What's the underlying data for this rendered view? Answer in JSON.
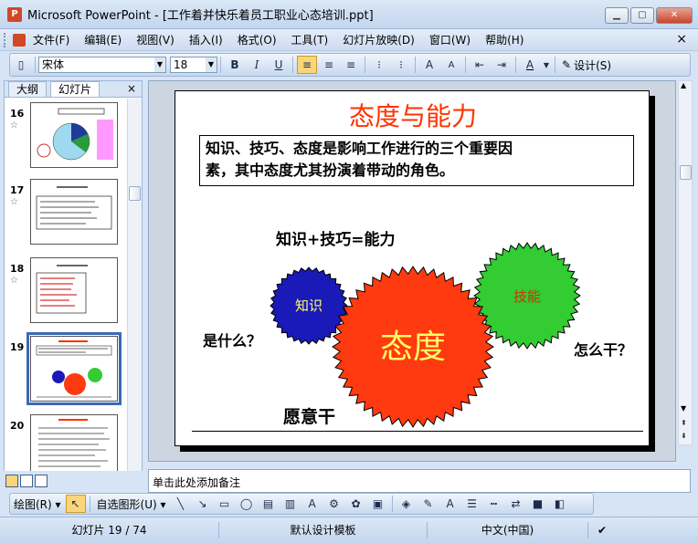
{
  "window": {
    "app_icon": "P",
    "title": "Microsoft PowerPoint - [工作着并快乐着员工职业心态培训.ppt]",
    "buttons": [
      "minimize",
      "maximize",
      "close"
    ]
  },
  "menu": {
    "items": [
      "文件(F)",
      "编辑(E)",
      "视图(V)",
      "插入(I)",
      "格式(O)",
      "工具(T)",
      "幻灯片放映(D)",
      "窗口(W)",
      "帮助(H)"
    ],
    "close_glyph": "×"
  },
  "toolbar": {
    "font_name": "宋体",
    "font_size": "18",
    "bold": "B",
    "italic": "I",
    "underline": "U",
    "design_label": "设计(S)"
  },
  "left_panel": {
    "tabs": [
      "大纲",
      "幻灯片"
    ],
    "close_glyph": "×",
    "slides": [
      {
        "number": "16",
        "has_star": true
      },
      {
        "number": "17",
        "has_star": true
      },
      {
        "number": "18",
        "has_star": true
      },
      {
        "number": "19",
        "has_star": false,
        "selected": true
      },
      {
        "number": "20",
        "has_star": false
      }
    ]
  },
  "slide": {
    "title": "态度与能力",
    "box_line1": "知识、技巧、态度是影响工作进行的三个重要因",
    "box_line2": "素，其中态度尤其扮演着带动的角色。",
    "formula": "知识+技巧=能力",
    "what": "是什么？",
    "how": "怎么干？",
    "willing": "愿意干",
    "gear_knowledge": "知识",
    "gear_attitude": "态度",
    "gear_skill": "技能",
    "colors": {
      "title": "#ff3300",
      "knowledge": "#1a1ab8",
      "attitude": "#ff3a10",
      "skill": "#33cc33"
    }
  },
  "notes": {
    "placeholder": "单击此处添加备注"
  },
  "drawbar": {
    "draw_label": "绘图(R)",
    "autoshape_label": "自选图形(U)"
  },
  "status": {
    "slide_info": "幻灯片 19 / 74",
    "template": "默认设计模板",
    "language": "中文(中国)"
  }
}
